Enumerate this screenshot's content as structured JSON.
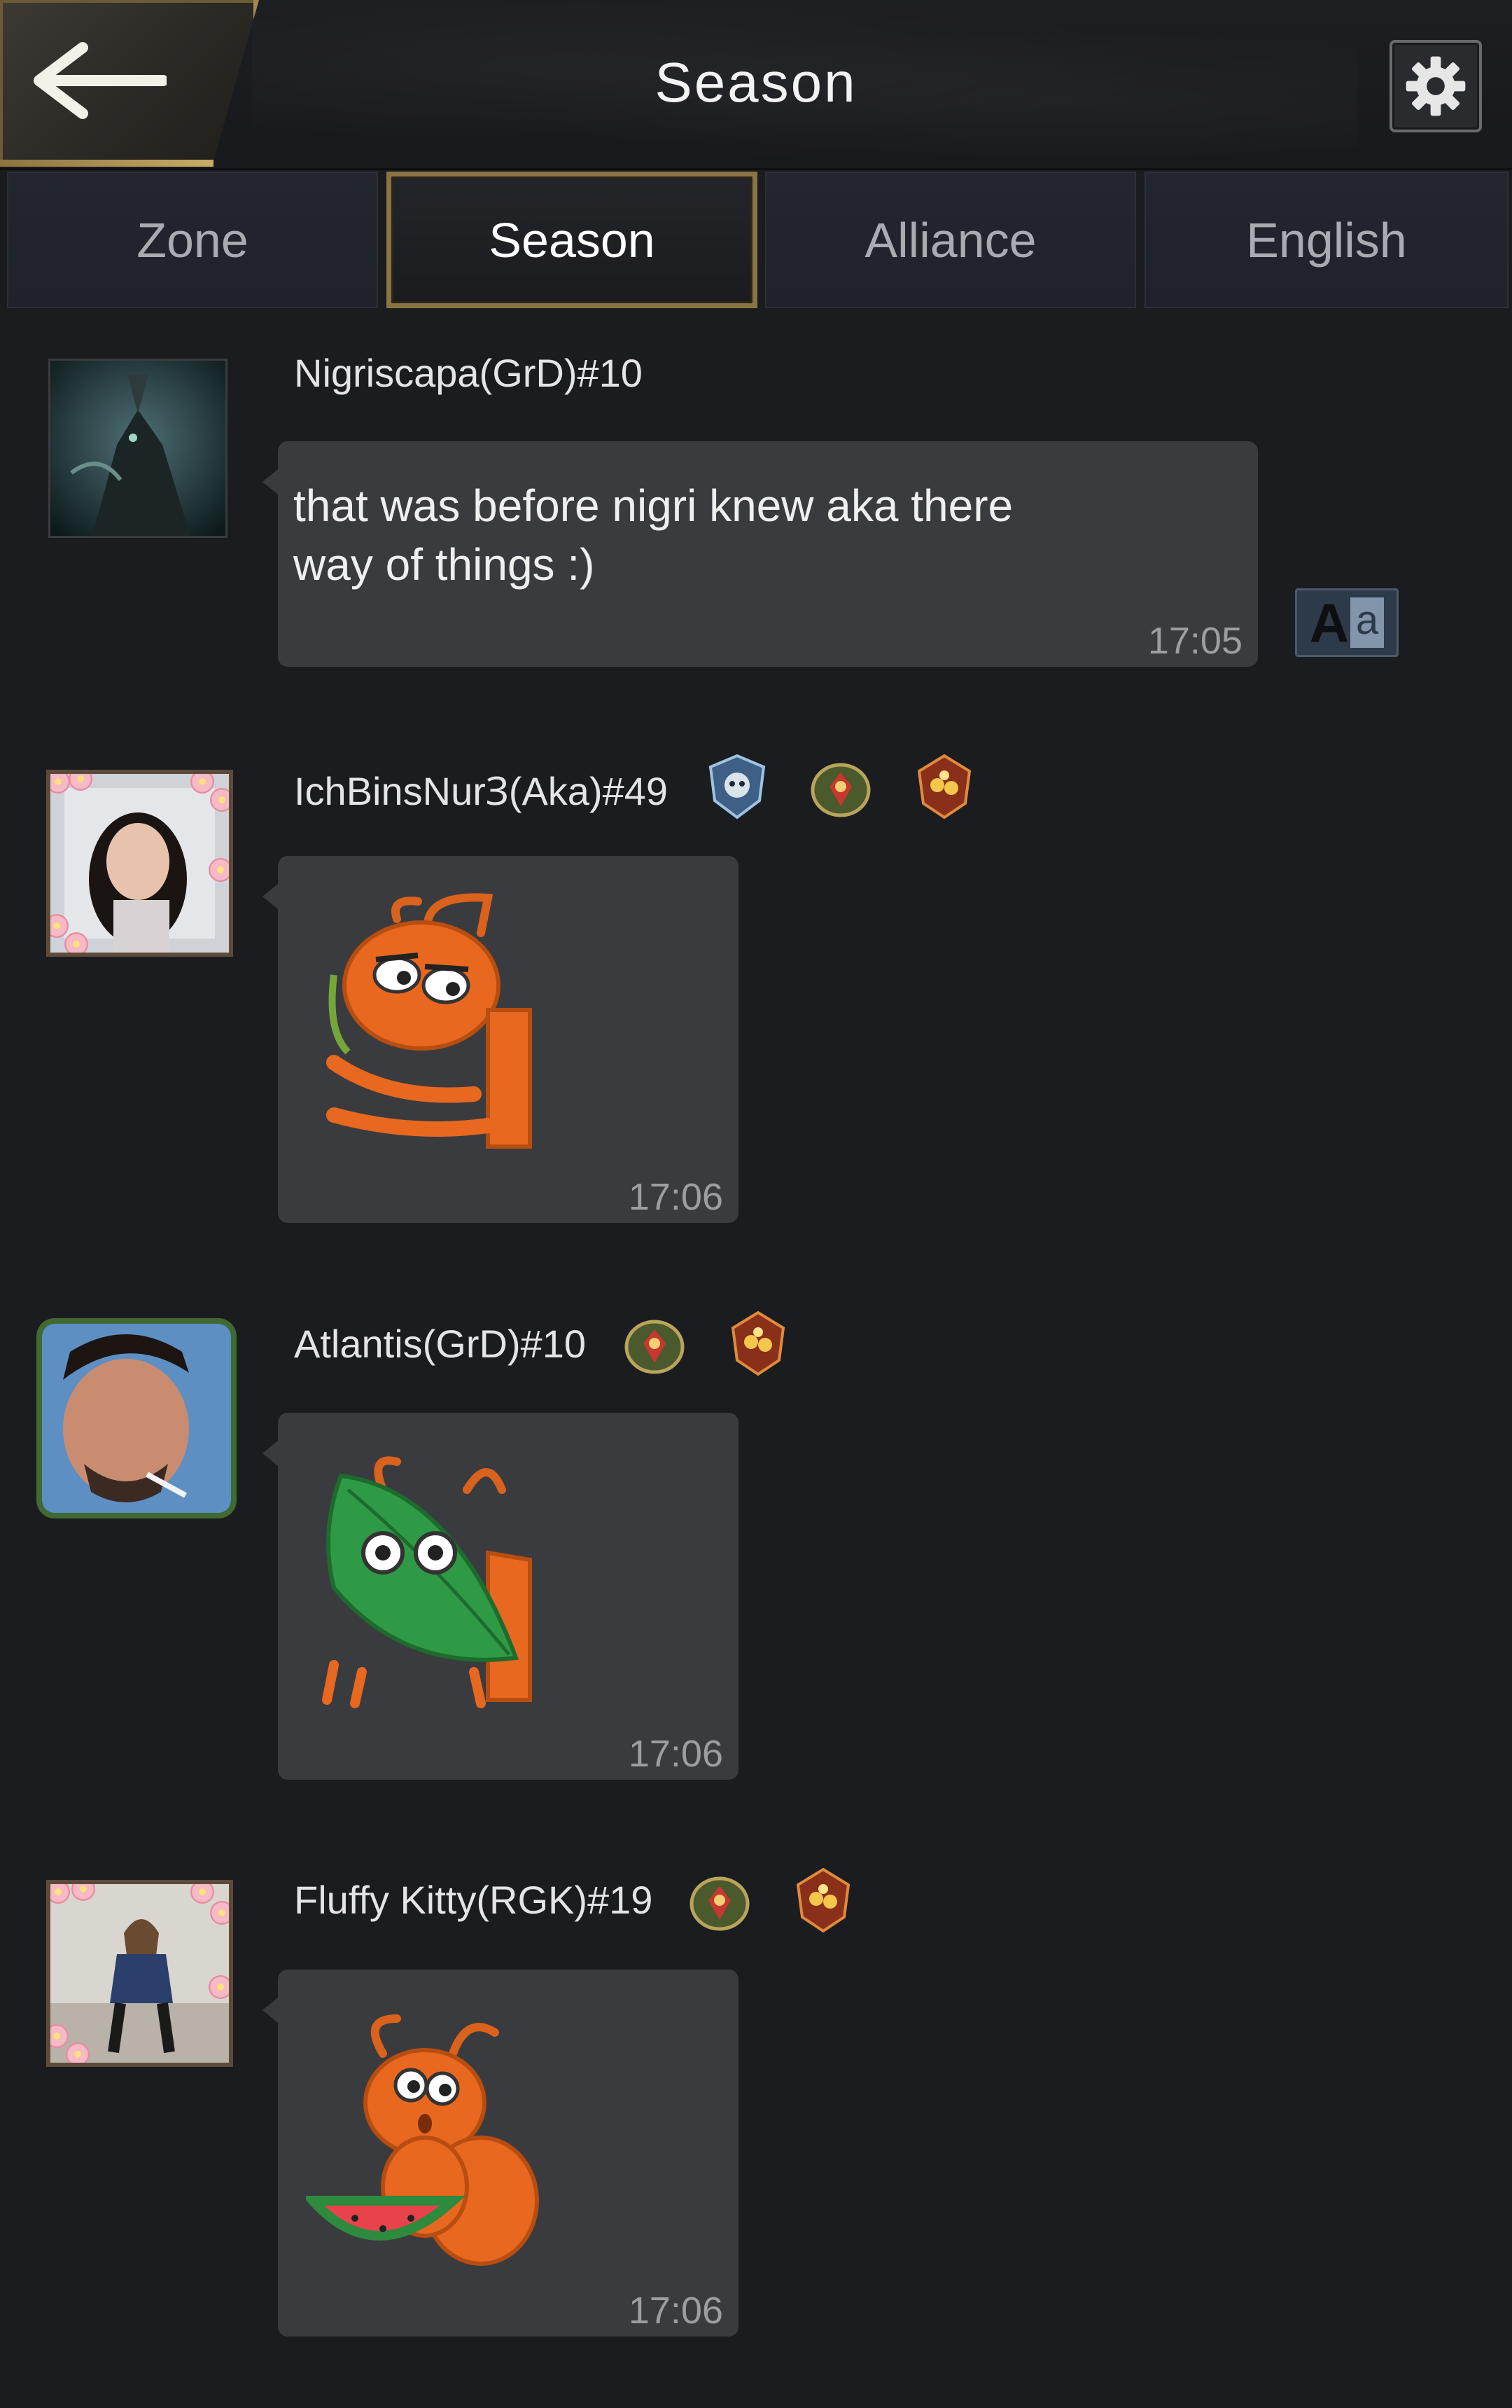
{
  "header": {
    "title": "Season",
    "back_icon": "back-arrow-icon",
    "settings_icon": "gear-icon"
  },
  "tabs": [
    {
      "label": "Zone",
      "active": false
    },
    {
      "label": "Season",
      "active": true
    },
    {
      "label": "Alliance",
      "active": false
    },
    {
      "label": "English",
      "active": false
    }
  ],
  "messages": [
    {
      "username": "Nigriscapa(GrD)#10",
      "text": "that was before nigri knew aka there way of things :)",
      "time": "17:05",
      "badges": [],
      "has_translate": true,
      "translate_label": "Aa"
    },
    {
      "username": "IchBinsNurꞫ(Aka)#49",
      "sticker": "ant-with-leaf-stem-sticker",
      "time": "17:06",
      "badges": [
        "skull-crest-badge-icon",
        "green-shield-badge-icon",
        "flame-shield-badge-icon"
      ]
    },
    {
      "username": "Atlantis(GrD)#10",
      "sticker": "ant-holding-leaf-sticker",
      "time": "17:06",
      "badges": [
        "green-shield-badge-icon",
        "flame-shield-badge-icon"
      ]
    },
    {
      "username": "Fluffy Kitty(RGK)#19",
      "sticker": "ant-eating-watermelon-sticker",
      "time": "17:06",
      "badges": [
        "green-shield-badge-icon",
        "flame-shield-badge-icon"
      ]
    }
  ],
  "colors": {
    "background": "#1b1c20",
    "bubble": "#3a3b3f",
    "gold_accent": "#8a7444",
    "ant_orange": "#e8681f",
    "leaf_green": "#2f9a45"
  }
}
